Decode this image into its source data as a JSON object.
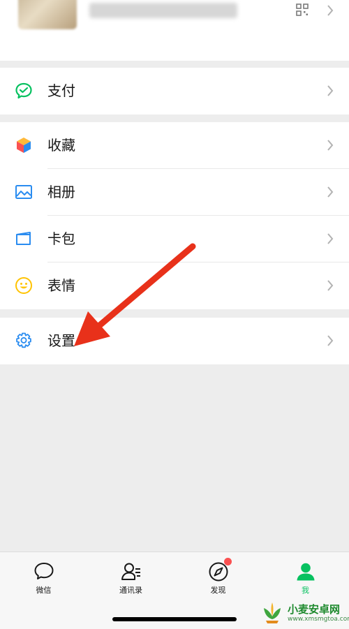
{
  "profile": {
    "qr_icon": "qr-code-icon"
  },
  "groups": [
    {
      "items": [
        {
          "label": "支付",
          "icon": "pay-icon"
        }
      ]
    },
    {
      "items": [
        {
          "label": "收藏",
          "icon": "favorites-icon"
        },
        {
          "label": "相册",
          "icon": "album-icon"
        },
        {
          "label": "卡包",
          "icon": "card-wallet-icon"
        },
        {
          "label": "表情",
          "icon": "sticker-icon"
        }
      ]
    },
    {
      "items": [
        {
          "label": "设置",
          "icon": "settings-icon"
        }
      ]
    }
  ],
  "tabbar": {
    "tabs": [
      {
        "label": "微信",
        "icon": "chats-icon",
        "active": false
      },
      {
        "label": "通讯录",
        "icon": "contacts-icon",
        "active": false
      },
      {
        "label": "发现",
        "icon": "discover-icon",
        "active": false,
        "badge": true
      },
      {
        "label": "我",
        "icon": "me-icon",
        "active": true
      }
    ]
  },
  "watermark": {
    "name": "小麦安卓网",
    "url": "www.xmsmgtoa.com"
  },
  "colors": {
    "accent": "#07c160",
    "badge": "#fa5151",
    "arrow": "#e8311a",
    "background": "#ededed"
  }
}
